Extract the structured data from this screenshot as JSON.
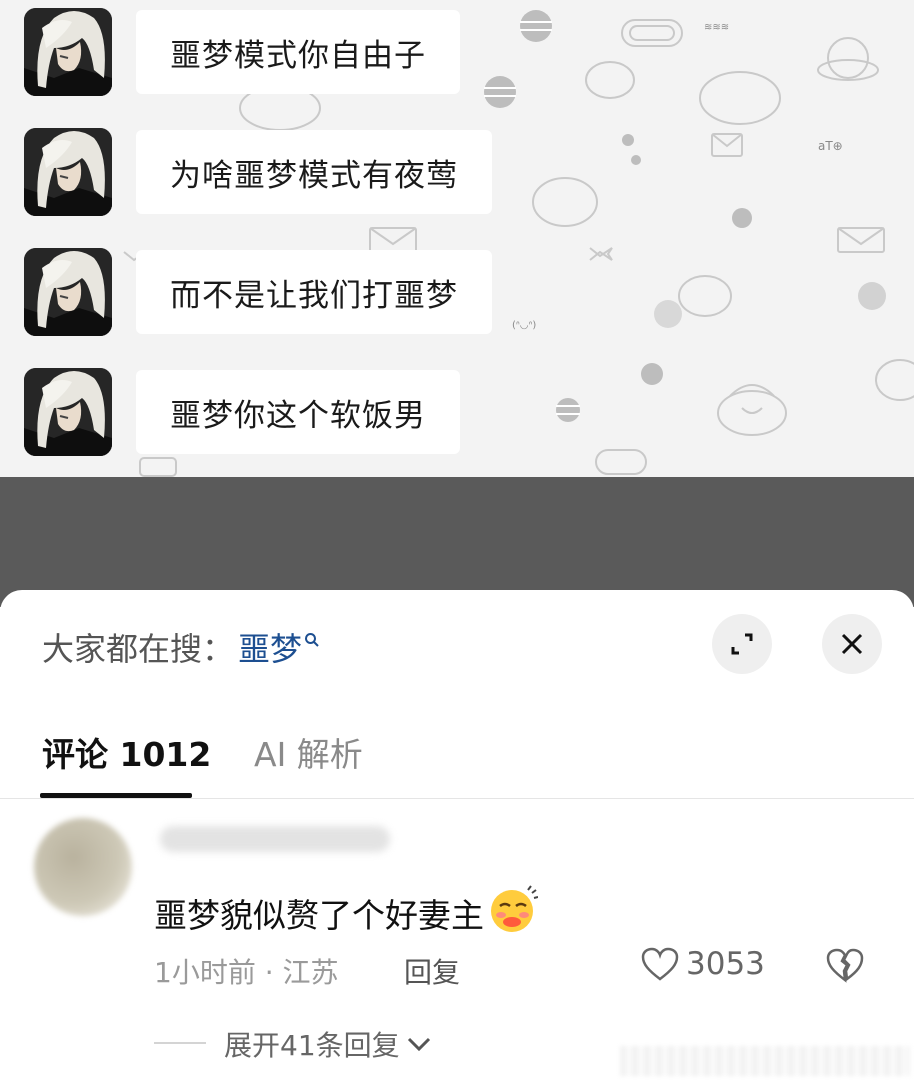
{
  "chat": {
    "messages": [
      {
        "text": "噩梦模式你自由子"
      },
      {
        "text": "为啥噩梦模式有夜莺"
      },
      {
        "text": "而不是让我们打噩梦"
      },
      {
        "text": "噩梦你这个软饭男"
      }
    ]
  },
  "sheet": {
    "search_prefix": "大家都在搜：",
    "search_keyword": "噩梦",
    "tabs": [
      {
        "label": "评论 1012",
        "active": true
      },
      {
        "label": "AI 解析",
        "active": false
      }
    ],
    "comment": {
      "text": "噩梦貌似赘了个好妻主",
      "emoji_icon": "shy-blush-emoji-icon",
      "meta": "1小时前 · 江苏",
      "reply_label": "回复",
      "like_count": "3053",
      "expand_label": "展开41条回复"
    }
  },
  "colors": {
    "keyword": "#1d4f91",
    "overlay": "#5a5a5a",
    "chat_bg": "#f3f3f3"
  }
}
